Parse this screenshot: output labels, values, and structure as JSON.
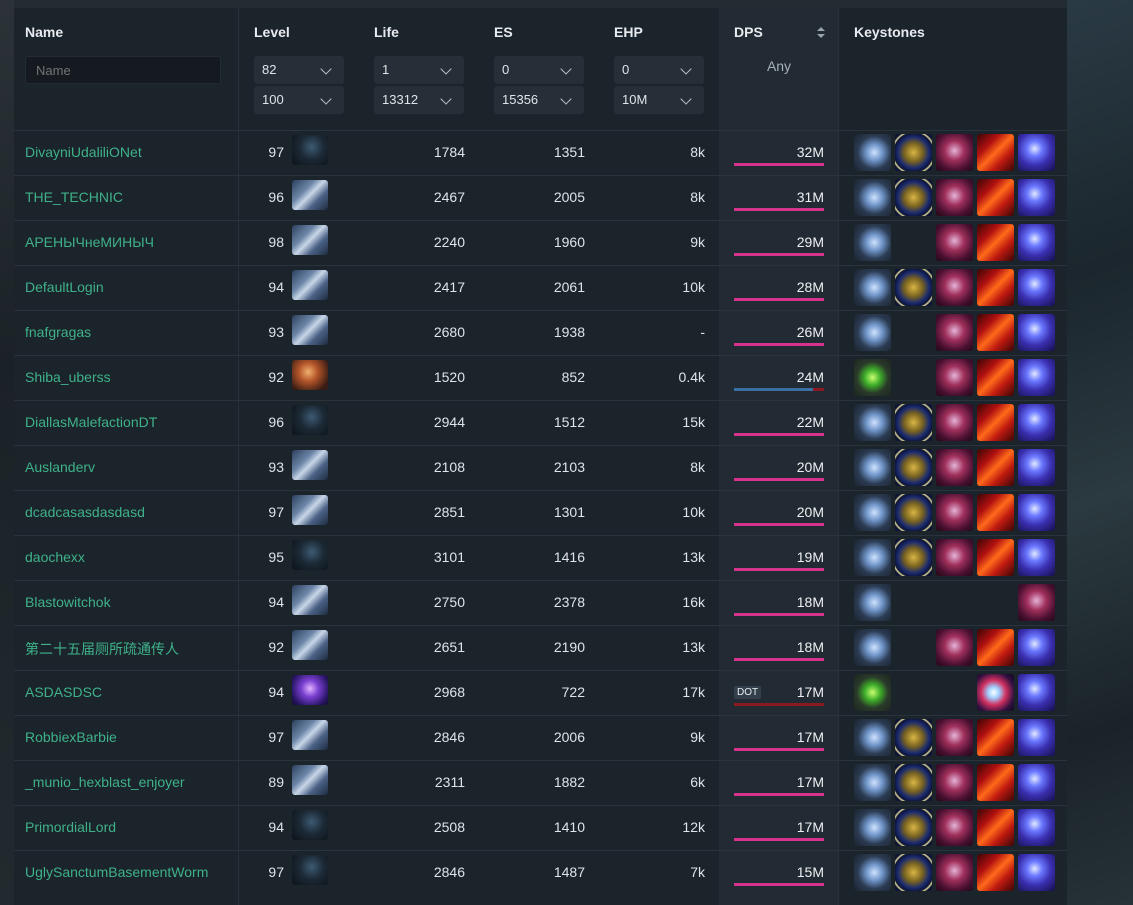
{
  "header": {
    "name": "Name",
    "level": "Level",
    "life": "Life",
    "es": "ES",
    "ehp": "EHP",
    "dps": "DPS",
    "keystones": "Keystones"
  },
  "filters": {
    "name_placeholder": "Name",
    "level_min": "82",
    "level_max": "100",
    "life_min": "1",
    "life_max": "13312",
    "es_min": "0",
    "es_max": "15356",
    "ehp_min": "0",
    "ehp_max": "10M",
    "dps_filter": "Any"
  },
  "colors": {
    "name_link": "#3fb28a",
    "dps_bar_pink": "#d6338f",
    "dps_bar_blue": "#3b6ea5",
    "dps_bar_red": "#8a1a1f"
  },
  "rows": [
    {
      "name": "DivayniUdaliliONet",
      "level": "97",
      "avatar": "dark-hood",
      "life": "1784",
      "es": "1351",
      "ehp": "8k",
      "dps": "32M",
      "dps_type": "hit",
      "dps_fraction": 1.0,
      "keystones": [
        "ghostly-blue-icon",
        "golden-fist-icon",
        "infinity-red-icon",
        "fire-slash-icon",
        "blue-spirit-icon"
      ]
    },
    {
      "name": "THE_TECHNIC",
      "level": "96",
      "avatar": "armored-blue",
      "life": "2467",
      "es": "2005",
      "ehp": "8k",
      "dps": "31M",
      "dps_type": "hit",
      "dps_fraction": 1.0,
      "keystones": [
        "ghostly-blue-icon",
        "golden-fist-icon",
        "infinity-red-icon",
        "fire-slash-icon",
        "blue-spirit-icon"
      ]
    },
    {
      "name": "АРЕНЫЧнеМИНЫЧ",
      "level": "98",
      "avatar": "armored-blue",
      "life": "2240",
      "es": "1960",
      "ehp": "9k",
      "dps": "29M",
      "dps_type": "hit",
      "dps_fraction": 1.0,
      "keystones": [
        "ghostly-blue-icon",
        "",
        "infinity-red-icon",
        "fire-slash-icon",
        "blue-spirit-icon"
      ]
    },
    {
      "name": "DefaultLogin",
      "level": "94",
      "avatar": "armored-blue",
      "life": "2417",
      "es": "2061",
      "ehp": "10k",
      "dps": "28M",
      "dps_type": "hit",
      "dps_fraction": 1.0,
      "keystones": [
        "ghostly-blue-icon",
        "golden-fist-icon",
        "infinity-red-icon",
        "fire-slash-icon",
        "blue-spirit-icon"
      ]
    },
    {
      "name": "fnafgragas",
      "level": "93",
      "avatar": "armored-blue",
      "life": "2680",
      "es": "1938",
      "ehp": "-",
      "dps": "26M",
      "dps_type": "hit",
      "dps_fraction": 1.0,
      "keystones": [
        "ghostly-blue-icon",
        "",
        "infinity-red-icon",
        "fire-slash-icon",
        "blue-spirit-icon"
      ]
    },
    {
      "name": "Shiba_uberss",
      "level": "92",
      "avatar": "fiery-warrior",
      "life": "1520",
      "es": "852",
      "ehp": "0.4k",
      "dps": "24M",
      "dps_type": "split",
      "dps_fraction": 0.88,
      "keystones": [
        "green-gem-icon",
        "",
        "infinity-red-icon",
        "fire-slash-icon",
        "blue-spirit-icon"
      ]
    },
    {
      "name": "DiallasMalefactionDT",
      "level": "96",
      "avatar": "dark-hood",
      "life": "2944",
      "es": "1512",
      "ehp": "15k",
      "dps": "22M",
      "dps_type": "hit",
      "dps_fraction": 1.0,
      "keystones": [
        "ghostly-blue-icon",
        "golden-fist-icon",
        "infinity-red-icon",
        "fire-slash-icon",
        "blue-spirit-icon"
      ]
    },
    {
      "name": "Auslanderv",
      "level": "93",
      "avatar": "armored-blue",
      "life": "2108",
      "es": "2103",
      "ehp": "8k",
      "dps": "20M",
      "dps_type": "hit",
      "dps_fraction": 1.0,
      "keystones": [
        "ghostly-blue-icon",
        "golden-fist-icon",
        "infinity-red-icon",
        "fire-slash-icon",
        "blue-spirit-icon"
      ]
    },
    {
      "name": "dcadcasasdasdasd",
      "level": "97",
      "avatar": "armored-blue",
      "life": "2851",
      "es": "1301",
      "ehp": "10k",
      "dps": "20M",
      "dps_type": "hit",
      "dps_fraction": 1.0,
      "keystones": [
        "ghostly-blue-icon",
        "golden-fist-icon",
        "infinity-red-icon",
        "fire-slash-icon",
        "blue-spirit-icon"
      ]
    },
    {
      "name": "daochexx",
      "level": "95",
      "avatar": "dark-hood",
      "life": "3101",
      "es": "1416",
      "ehp": "13k",
      "dps": "19M",
      "dps_type": "hit",
      "dps_fraction": 1.0,
      "keystones": [
        "ghostly-blue-icon",
        "golden-fist-icon",
        "infinity-red-icon",
        "fire-slash-icon",
        "blue-spirit-icon"
      ]
    },
    {
      "name": "Blastowitchok",
      "level": "94",
      "avatar": "armored-blue",
      "life": "2750",
      "es": "2378",
      "ehp": "16k",
      "dps": "18M",
      "dps_type": "hit",
      "dps_fraction": 1.0,
      "keystones": [
        "ghostly-blue-icon",
        "",
        "",
        "",
        "infinity-red-icon"
      ]
    },
    {
      "name": "第二十五届厕所疏通传人",
      "level": "92",
      "avatar": "armored-blue",
      "life": "2651",
      "es": "2190",
      "ehp": "13k",
      "dps": "18M",
      "dps_type": "hit",
      "dps_fraction": 1.0,
      "keystones": [
        "ghostly-blue-icon",
        "",
        "infinity-red-icon",
        "fire-slash-icon",
        "blue-spirit-icon"
      ]
    },
    {
      "name": "ASDASDSC",
      "level": "94",
      "avatar": "purple-mage",
      "life": "2968",
      "es": "722",
      "ehp": "17k",
      "dps": "17M",
      "dps_type": "dot",
      "dot_label": "DOT",
      "dps_fraction": 1.0,
      "keystones": [
        "green-gem-icon",
        "",
        "",
        "lightning-burst-icon",
        "blue-spirit-icon"
      ]
    },
    {
      "name": "RobbiexBarbie",
      "level": "97",
      "avatar": "armored-blue",
      "life": "2846",
      "es": "2006",
      "ehp": "9k",
      "dps": "17M",
      "dps_type": "hit",
      "dps_fraction": 1.0,
      "keystones": [
        "ghostly-blue-icon",
        "golden-fist-icon",
        "infinity-red-icon",
        "fire-slash-icon",
        "blue-spirit-icon"
      ]
    },
    {
      "name": "_munio_hexblast_enjoyer",
      "level": "89",
      "avatar": "armored-blue",
      "life": "2311",
      "es": "1882",
      "ehp": "6k",
      "dps": "17M",
      "dps_type": "hit",
      "dps_fraction": 1.0,
      "keystones": [
        "ghostly-blue-icon",
        "golden-fist-icon",
        "infinity-red-icon",
        "fire-slash-icon",
        "blue-spirit-icon"
      ]
    },
    {
      "name": "PrimordialLord",
      "level": "94",
      "avatar": "dark-hood",
      "life": "2508",
      "es": "1410",
      "ehp": "12k",
      "dps": "17M",
      "dps_type": "hit",
      "dps_fraction": 1.0,
      "keystones": [
        "ghostly-blue-icon",
        "golden-fist-icon",
        "infinity-red-icon",
        "fire-slash-icon",
        "blue-spirit-icon"
      ]
    },
    {
      "name": "UglySanctumBasementWorm",
      "level": "97",
      "avatar": "dark-hood",
      "life": "2846",
      "es": "1487",
      "ehp": "7k",
      "dps": "15M",
      "dps_type": "hit",
      "dps_fraction": 1.0,
      "keystones": [
        "ghostly-blue-icon",
        "golden-fist-icon",
        "infinity-red-icon",
        "fire-slash-icon",
        "blue-spirit-icon"
      ]
    }
  ]
}
